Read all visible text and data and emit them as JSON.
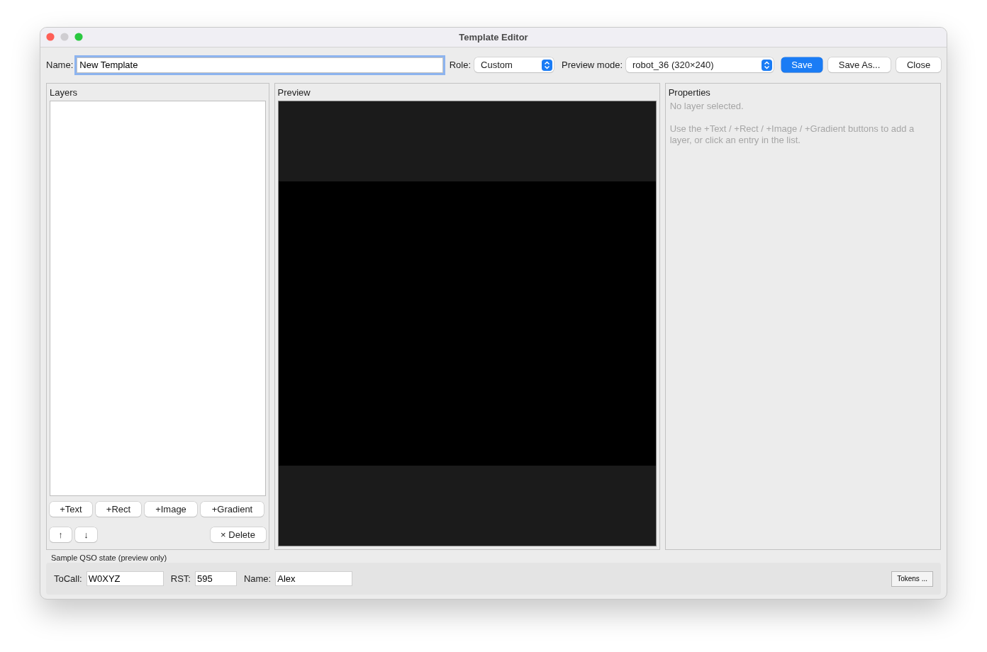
{
  "window": {
    "title": "Template Editor"
  },
  "toolbar": {
    "name": {
      "label": "Name:",
      "value": "New Template",
      "focused": true
    },
    "role": {
      "label": "Role:",
      "value": "Custom"
    },
    "preview_mode": {
      "label": "Preview mode:",
      "value": "robot_36 (320×240)"
    },
    "buttons": [
      {
        "label": "Save",
        "kind": "primary"
      },
      {
        "label": "Save As...",
        "kind": "default"
      },
      {
        "label": "Close",
        "kind": "default"
      }
    ]
  },
  "layers": {
    "title": "Layers",
    "add_buttons": [
      "+Text",
      "+Rect",
      "+Image",
      "+Gradient"
    ],
    "move_buttons": [
      "↑",
      "↓"
    ],
    "delete_button": "× Delete"
  },
  "preview": {
    "title": "Preview"
  },
  "properties": {
    "title": "Properties",
    "messages": [
      "No layer selected.",
      "Use the +Text / +Rect / +Image / +Gradient buttons to add a layer, or click an entry in the list."
    ]
  },
  "sample_qso": {
    "title": "Sample QSO state (preview only)",
    "fields": [
      {
        "label": "ToCall:",
        "value": "W0XYZ"
      },
      {
        "label": "RST:",
        "value": "595"
      },
      {
        "label": "Name:",
        "value": "Alex"
      }
    ],
    "tokens_button": "Tokens ..."
  }
}
